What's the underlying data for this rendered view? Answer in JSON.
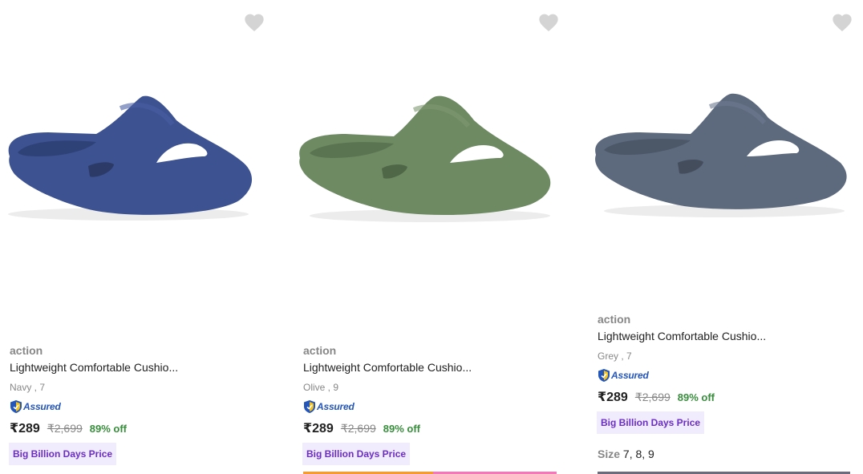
{
  "products": [
    {
      "brand": "action",
      "title": "Lightweight Comfortable Cushio...",
      "variant": "Navy , 7",
      "assured": "Assured",
      "price": "₹289",
      "mrp": "₹2,699",
      "discount": "89% off",
      "deal": "Big Billion Days Price",
      "color": "#3d5291",
      "wishlist_icon": "heart-icon"
    },
    {
      "brand": "action",
      "title": "Lightweight Comfortable Cushio...",
      "variant": "Olive , 9",
      "assured": "Assured",
      "price": "₹289",
      "mrp": "₹2,699",
      "discount": "89% off",
      "deal": "Big Billion Days Price",
      "color": "#6e8a62",
      "wishlist_icon": "heart-icon"
    },
    {
      "brand": "action",
      "title": "Lightweight Comfortable Cushio...",
      "variant": "Grey , 7",
      "assured": "Assured",
      "price": "₹289",
      "mrp": "₹2,699",
      "discount": "89% off",
      "deal": "Big Billion Days Price",
      "size_label": "Size",
      "sizes": "7, 8, 9",
      "color": "#5d6a7e",
      "wishlist_icon": "heart-icon"
    }
  ],
  "colors": {
    "heart": "#d4d4d4",
    "discount": "#388e3c",
    "deal_bg": "#f1ecfd",
    "deal_text": "#6b2ec5",
    "assured": "#2455b8"
  }
}
